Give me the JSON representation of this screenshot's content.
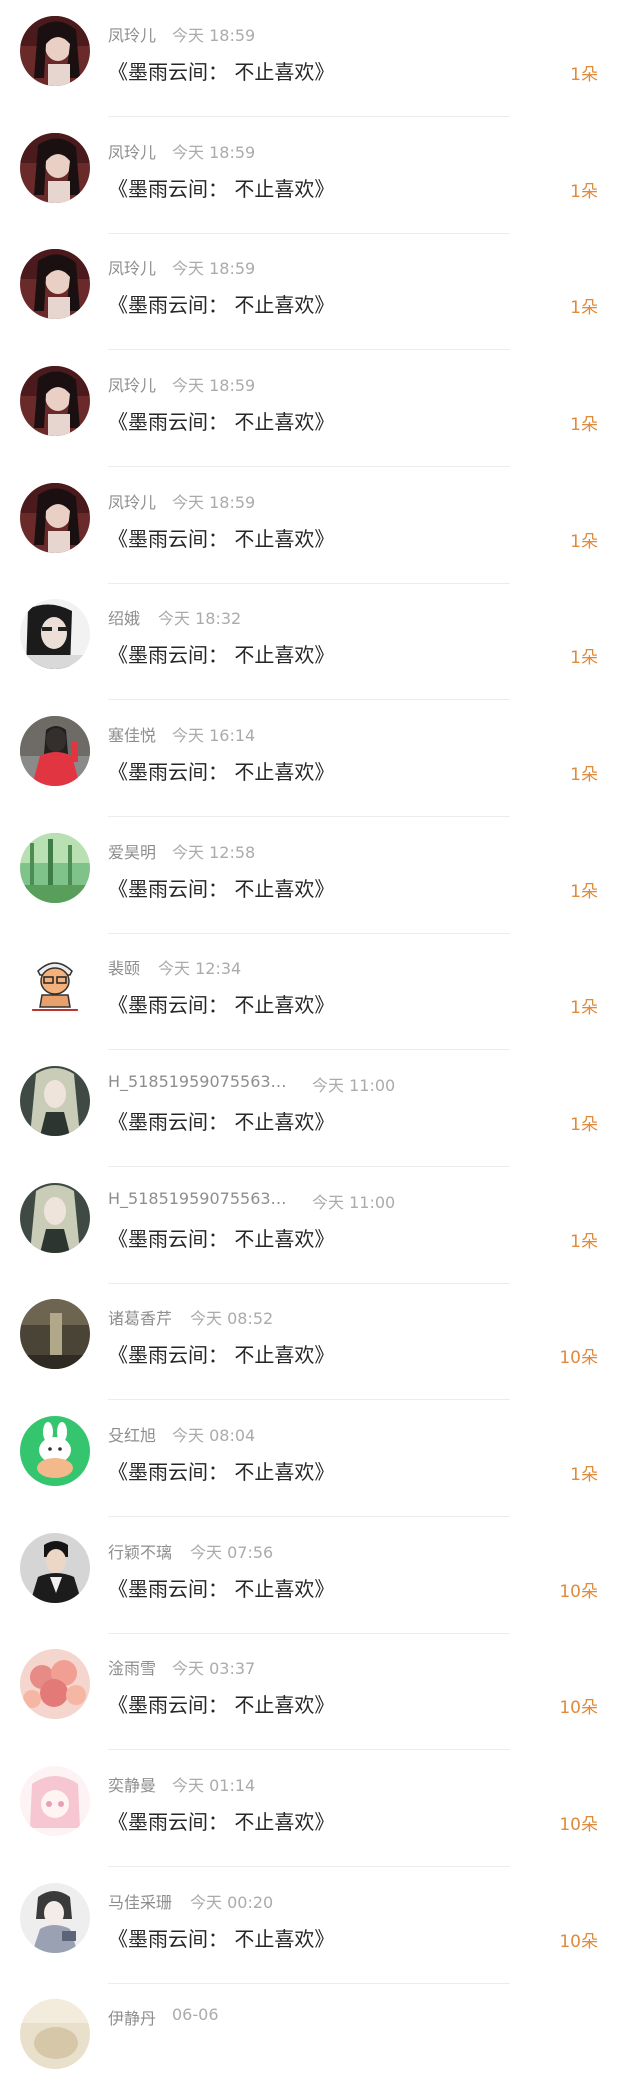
{
  "records": [
    {
      "name": "凤玲儿",
      "time": "今天 18:59",
      "gift": "《墨雨云间： 不止喜欢》",
      "count": "1朵",
      "avatar_icon": "dark-hair-girl-avatar"
    },
    {
      "name": "凤玲儿",
      "time": "今天 18:59",
      "gift": "《墨雨云间： 不止喜欢》",
      "count": "1朵",
      "avatar_icon": "dark-hair-girl-avatar"
    },
    {
      "name": "凤玲儿",
      "time": "今天 18:59",
      "gift": "《墨雨云间： 不止喜欢》",
      "count": "1朵",
      "avatar_icon": "dark-hair-girl-avatar"
    },
    {
      "name": "凤玲儿",
      "time": "今天 18:59",
      "gift": "《墨雨云间： 不止喜欢》",
      "count": "1朵",
      "avatar_icon": "dark-hair-girl-avatar"
    },
    {
      "name": "凤玲儿",
      "time": "今天 18:59",
      "gift": "《墨雨云间： 不止喜欢》",
      "count": "1朵",
      "avatar_icon": "dark-hair-girl-avatar"
    },
    {
      "name": "绍娥",
      "time": "今天 18:32",
      "gift": "《墨雨云间： 不止喜欢》",
      "count": "1朵",
      "avatar_icon": "bw-portrait-avatar"
    },
    {
      "name": "塞佳悦",
      "time": "今天 16:14",
      "gift": "《墨雨云间： 不止喜欢》",
      "count": "1朵",
      "avatar_icon": "girl-red-shirt-avatar"
    },
    {
      "name": "爱昊明",
      "time": "今天 12:58",
      "gift": "《墨雨云间： 不止喜欢》",
      "count": "1朵",
      "avatar_icon": "green-forest-avatar"
    },
    {
      "name": "裴颐",
      "time": "今天 12:34",
      "gift": "《墨雨云间： 不止喜欢》",
      "count": "1朵",
      "avatar_icon": "cartoon-man-avatar"
    },
    {
      "name": "H_51851959075563…",
      "time": "今天 11:00",
      "gift": "《墨雨云间： 不止喜欢》",
      "count": "1朵",
      "avatar_icon": "anime-long-hair-avatar"
    },
    {
      "name": "H_51851959075563…",
      "time": "今天 11:00",
      "gift": "《墨雨云间： 不止喜欢》",
      "count": "1朵",
      "avatar_icon": "anime-long-hair-avatar"
    },
    {
      "name": "诸葛香芹",
      "time": "今天 08:52",
      "gift": "《墨雨云间： 不止喜欢》",
      "count": "10朵",
      "avatar_icon": "dim-scene-avatar"
    },
    {
      "name": "殳红旭",
      "time": "今天 08:04",
      "gift": "《墨雨云间： 不止喜欢》",
      "count": "1朵",
      "avatar_icon": "white-bunny-avatar"
    },
    {
      "name": "行颖不璃",
      "time": "今天 07:56",
      "gift": "《墨雨云间： 不止喜欢》",
      "count": "10朵",
      "avatar_icon": "man-portrait-avatar"
    },
    {
      "name": "淦雨雪",
      "time": "今天 03:37",
      "gift": "《墨雨云间： 不止喜欢》",
      "count": "10朵",
      "avatar_icon": "pink-flowers-avatar"
    },
    {
      "name": "奕静曼",
      "time": "今天 01:14",
      "gift": "《墨雨云间： 不止喜欢》",
      "count": "10朵",
      "avatar_icon": "pink-anime-avatar"
    },
    {
      "name": "马佳采珊",
      "time": "今天 00:20",
      "gift": "《墨雨云间： 不止喜欢》",
      "count": "10朵",
      "avatar_icon": "sketch-portrait-avatar"
    },
    {
      "name": "伊静丹",
      "time": "06-06",
      "gift": "",
      "count": "",
      "avatar_icon": "beige-avatar"
    }
  ]
}
